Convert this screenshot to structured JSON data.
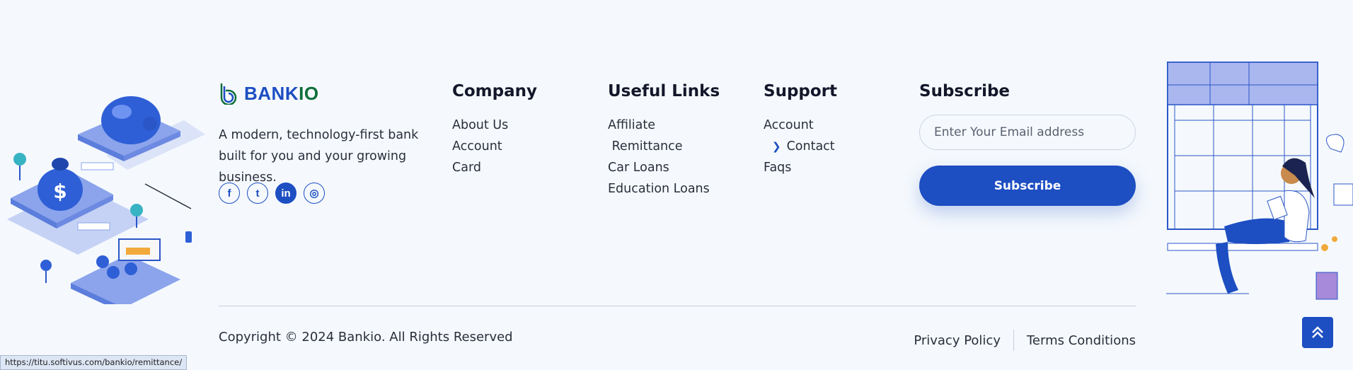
{
  "brand": {
    "name_part1": "BANK",
    "name_part2": "IO",
    "logo_icon": "bankio-logo-icon"
  },
  "about": {
    "text": "A modern, technology-first bank built for you and your growing business."
  },
  "socials": [
    {
      "icon": "facebook-icon",
      "glyph": "f"
    },
    {
      "icon": "twitter-icon",
      "glyph": "t"
    },
    {
      "icon": "linkedin-icon",
      "glyph": "in"
    },
    {
      "icon": "instagram-icon",
      "glyph": "◎"
    }
  ],
  "company": {
    "title": "Company",
    "items": [
      "About Us",
      "Account",
      "Card"
    ]
  },
  "useful_links": {
    "title": "Useful Links",
    "items": [
      "Affiliate",
      " Remittance",
      "Car Loans",
      "Education Loans"
    ]
  },
  "support": {
    "title": "Support",
    "items": [
      "Account",
      "Contact",
      "Faqs"
    ]
  },
  "subscribe": {
    "title": "Subscribe",
    "placeholder": "Enter Your Email address",
    "button_label": "Subscribe"
  },
  "footer": {
    "copyright": "Copyright © 2024 Bankio. All Rights Reserved",
    "privacy": "Privacy Policy",
    "terms": "Terms Conditions"
  },
  "status_bar": {
    "url": "https://titu.softivus.com/bankio/remittance/"
  },
  "colors": {
    "accent": "#1d4ec2",
    "brand_green": "#0f6e3a",
    "background": "#f5f9fd"
  }
}
